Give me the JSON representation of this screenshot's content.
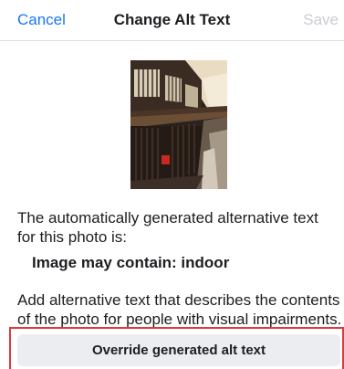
{
  "navbar": {
    "cancel_label": "Cancel",
    "title": "Change Alt Text",
    "save_label": "Save"
  },
  "content": {
    "info_text": "The automatically generated alternative text for this photo is:",
    "generated_alt_text": "Image may contain: indoor",
    "description_text": "Add alternative text that describes the contents of the photo for people with visual impairments.",
    "override_button_label": "Override generated alt text"
  },
  "colors": {
    "accent": "#1877f2",
    "disabled": "#c9ccd1",
    "button_bg": "#ebedf0",
    "highlight": "#e0393e"
  }
}
